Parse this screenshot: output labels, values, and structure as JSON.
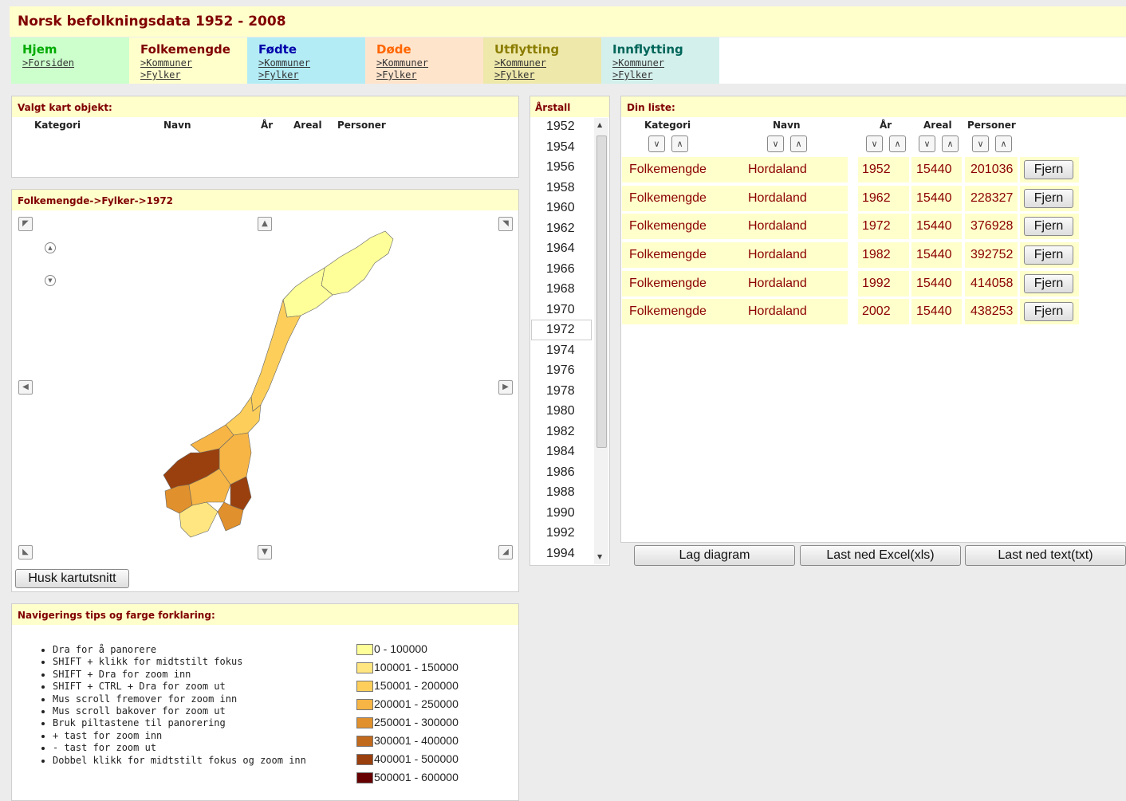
{
  "app_title": "Norsk befolkningsdata 1952 - 2008",
  "nav": [
    {
      "title": "Hjem",
      "links": [
        ">Forsiden"
      ],
      "bg": "#ccffcc",
      "color": "#00aa00"
    },
    {
      "title": "Folkemengde",
      "links": [
        ">Kommuner",
        ">Fylker"
      ],
      "bg": "#ffffcc",
      "color": "#800000"
    },
    {
      "title": "Fødte",
      "links": [
        ">Kommuner",
        ">Fylker"
      ],
      "bg": "#b3ecf5",
      "color": "#0000aa"
    },
    {
      "title": "Døde",
      "links": [
        ">Kommuner",
        ">Fylker"
      ],
      "bg": "#ffe4cc",
      "color": "#ff6600"
    },
    {
      "title": "Utflytting",
      "links": [
        ">Kommuner",
        ">Fylker"
      ],
      "bg": "#eee8aa",
      "color": "#8b7d00"
    },
    {
      "title": "Innflytting",
      "links": [
        ">Kommuner",
        ">Fylker"
      ],
      "bg": "#d4f0ec",
      "color": "#00665a"
    }
  ],
  "selected_panel": {
    "title": "Valgt kart objekt:",
    "columns": [
      "Kategori",
      "Navn",
      "År",
      "Areal",
      "Personer"
    ]
  },
  "map_panel": {
    "title": "Folkemengde->Fylker->1972",
    "save_button": "Husk kartutsnitt"
  },
  "years_panel": {
    "title": "Årstall",
    "selected": "1972",
    "years": [
      "1952",
      "1954",
      "1956",
      "1958",
      "1960",
      "1962",
      "1964",
      "1966",
      "1968",
      "1970",
      "1972",
      "1974",
      "1976",
      "1978",
      "1980",
      "1982",
      "1984",
      "1986",
      "1988",
      "1990",
      "1992",
      "1994"
    ]
  },
  "list_panel": {
    "title": "Din liste:",
    "columns": [
      "Kategori",
      "Navn",
      "År",
      "Areal",
      "Personer"
    ],
    "remove_label": "Fjern",
    "rows": [
      {
        "kategori": "Folkemengde",
        "navn": "Hordaland",
        "aar": "1952",
        "areal": "15440",
        "personer": "201036"
      },
      {
        "kategori": "Folkemengde",
        "navn": "Hordaland",
        "aar": "1962",
        "areal": "15440",
        "personer": "228327"
      },
      {
        "kategori": "Folkemengde",
        "navn": "Hordaland",
        "aar": "1972",
        "areal": "15440",
        "personer": "376928"
      },
      {
        "kategori": "Folkemengde",
        "navn": "Hordaland",
        "aar": "1982",
        "areal": "15440",
        "personer": "392752"
      },
      {
        "kategori": "Folkemengde",
        "navn": "Hordaland",
        "aar": "1992",
        "areal": "15440",
        "personer": "414058"
      },
      {
        "kategori": "Folkemengde",
        "navn": "Hordaland",
        "aar": "2002",
        "areal": "15440",
        "personer": "438253"
      }
    ],
    "buttons": {
      "diagram": "Lag diagram",
      "excel": "Last ned Excel(xls)",
      "text": "Last ned text(txt)"
    }
  },
  "tips_panel": {
    "title": "Navigerings tips og farge forklaring:",
    "tips": [
      "Dra for å panorere",
      "SHIFT + klikk for midtstilt fokus",
      "SHIFT + Dra for zoom inn",
      "SHIFT + CTRL + Dra for zoom ut",
      "Mus scroll fremover for zoom inn",
      "Mus scroll bakover for zoom ut",
      "Bruk piltastene til panorering",
      "+ tast for zoom inn",
      "- tast for zoom ut",
      "Dobbel klikk for midtstilt fokus og zoom inn"
    ],
    "legend": [
      {
        "label": "0 - 100000",
        "color": "#ffff99"
      },
      {
        "label": "100001 - 150000",
        "color": "#ffe680"
      },
      {
        "label": "150001 - 200000",
        "color": "#fdcf5a"
      },
      {
        "label": "200001 - 250000",
        "color": "#f6b545"
      },
      {
        "label": "250001 - 300000",
        "color": "#e0902c"
      },
      {
        "label": "300001 - 400000",
        "color": "#c06a1e"
      },
      {
        "label": "400001 - 500000",
        "color": "#9a400e"
      },
      {
        "label": "500001 - 600000",
        "color": "#660000"
      }
    ]
  }
}
